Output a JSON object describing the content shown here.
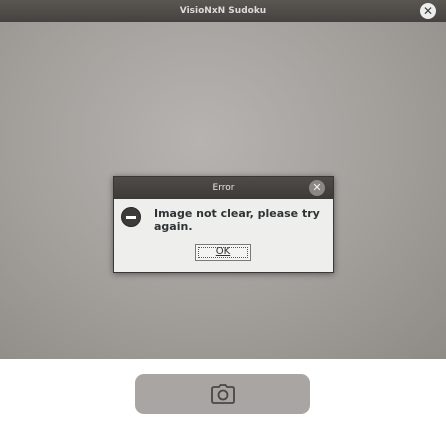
{
  "window": {
    "title": "VisioNxN Sudoku",
    "close_glyph": "✕"
  },
  "camera": {
    "icon": "camera-icon"
  },
  "dialog": {
    "title": "Error",
    "close_glyph": "✕",
    "icon": "error-icon",
    "message": "Image not clear, please try again.",
    "ok_label": "OK"
  }
}
